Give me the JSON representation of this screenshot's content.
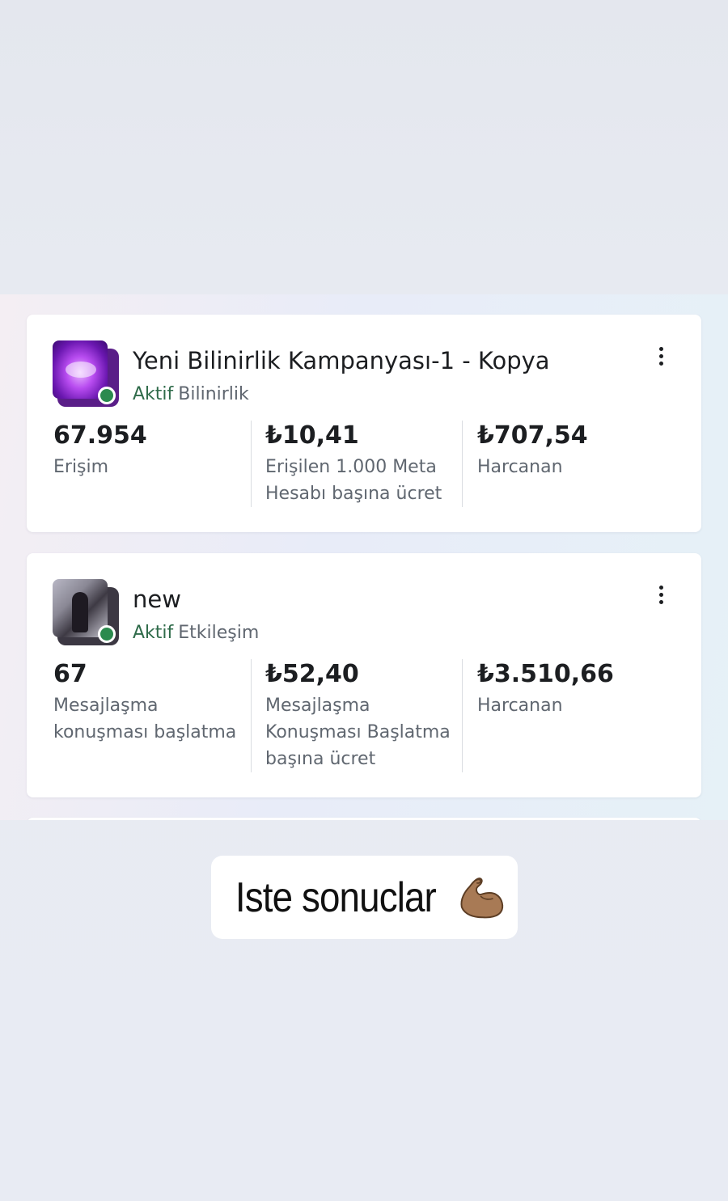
{
  "campaigns": [
    {
      "title": "Yeni Bilinirlik Kampanyası-1 - Kopya",
      "status": "Aktif",
      "objective": "Bilinirlik",
      "metrics": [
        {
          "value": "67.954",
          "label": "Erişim"
        },
        {
          "value": "₺10,41",
          "label": "Erişilen 1.000 Meta Hesabı başına ücret"
        },
        {
          "value": "₺707,54",
          "label": "Harcanan"
        }
      ]
    },
    {
      "title": "new",
      "status": "Aktif",
      "objective": "Etkileşim",
      "metrics": [
        {
          "value": "67",
          "label": "Mesajlaşma konuşması başlatma"
        },
        {
          "value": "₺52,40",
          "label": "Mesajlaşma Konuşması Başlatma başına ücret"
        },
        {
          "value": "₺3.510,66",
          "label": "Harcanan"
        }
      ]
    }
  ],
  "caption": {
    "text": "Iste sonuclar",
    "emoji_icon": "flexed-biceps-icon"
  },
  "colors": {
    "active_status": "#2f6b4a",
    "status_dot": "#2b8a4e",
    "muted_text": "#606770",
    "primary_text": "#1c1e21"
  }
}
